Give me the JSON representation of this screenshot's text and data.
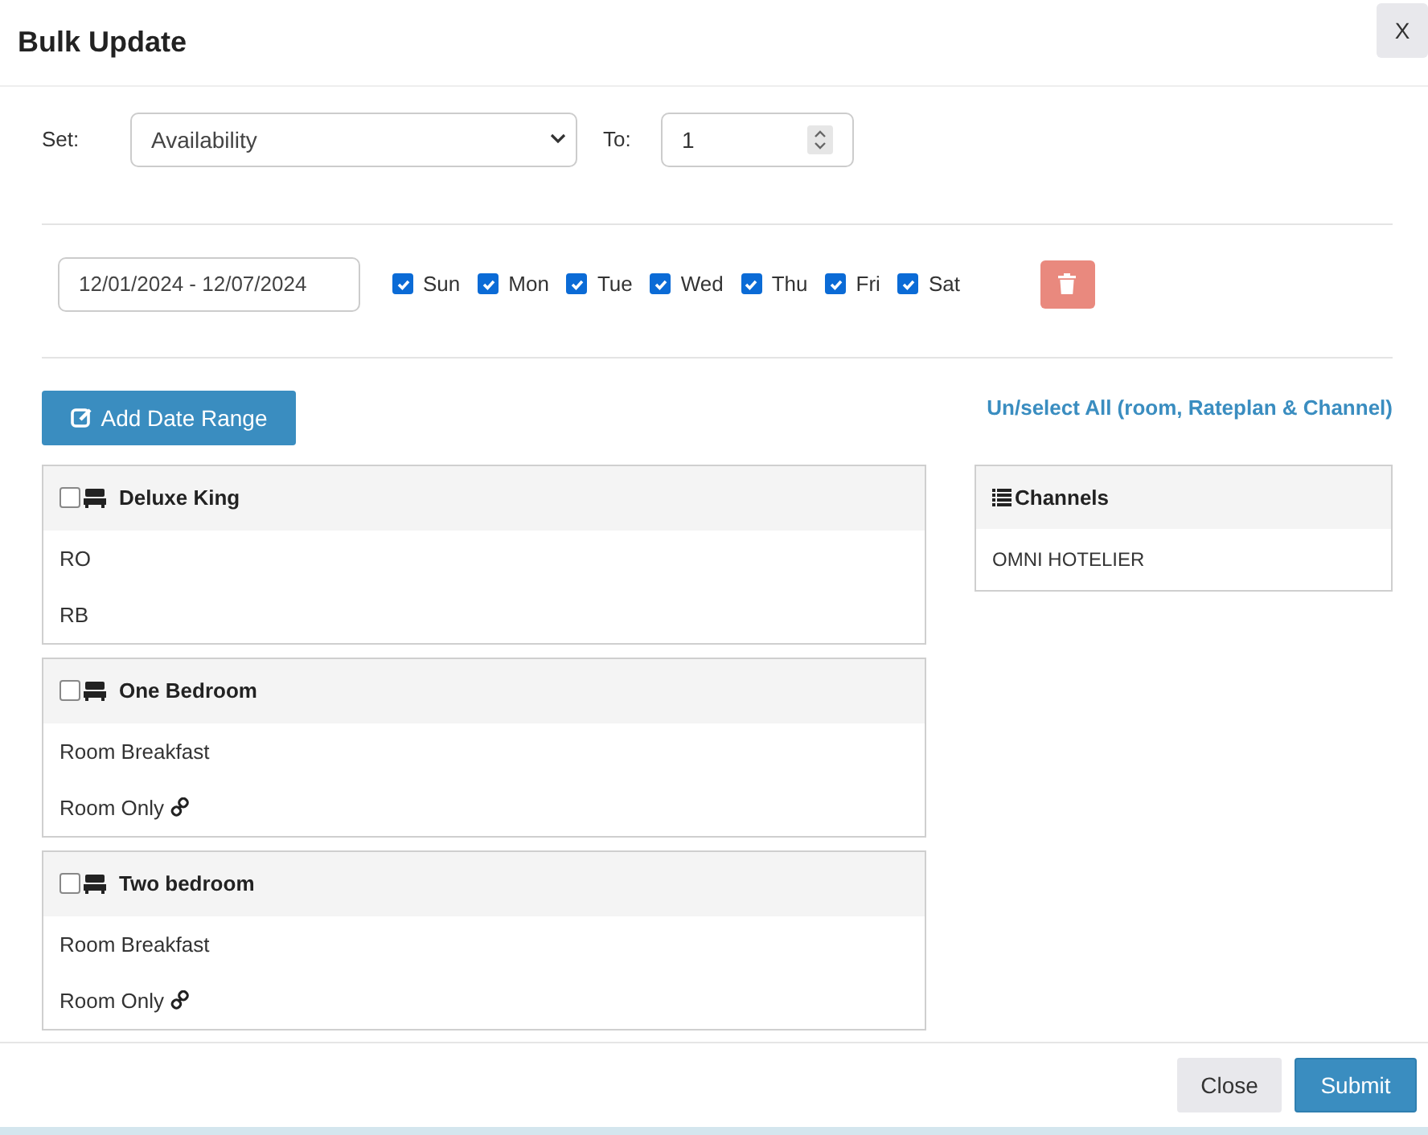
{
  "modal": {
    "title": "Bulk Update",
    "close_label": "X"
  },
  "set_row": {
    "set_label": "Set:",
    "field": "Availability",
    "to_label": "To:",
    "value": "1"
  },
  "date_ranges": [
    {
      "range": "12/01/2024 - 12/07/2024",
      "days": [
        {
          "label": "Sun",
          "checked": true
        },
        {
          "label": "Mon",
          "checked": true
        },
        {
          "label": "Tue",
          "checked": true
        },
        {
          "label": "Wed",
          "checked": true
        },
        {
          "label": "Thu",
          "checked": true
        },
        {
          "label": "Fri",
          "checked": true
        },
        {
          "label": "Sat",
          "checked": true
        }
      ]
    }
  ],
  "add_button": "Add Date Range",
  "select_all_link": "Un/select All (room, Rateplan & Channel)",
  "rooms": [
    {
      "name": "Deluxe King",
      "checked": false,
      "rate_plans": [
        {
          "name": "RO",
          "linked": false
        },
        {
          "name": "RB",
          "linked": false
        }
      ]
    },
    {
      "name": "One Bedroom",
      "checked": false,
      "rate_plans": [
        {
          "name": "Room Breakfast",
          "linked": false
        },
        {
          "name": "Room Only",
          "linked": true
        }
      ]
    },
    {
      "name": "Two bedroom",
      "checked": false,
      "rate_plans": [
        {
          "name": "Room Breakfast",
          "linked": false
        },
        {
          "name": "Room Only",
          "linked": true
        }
      ]
    }
  ],
  "channels": {
    "title": "Channels",
    "items": [
      "OMNI HOTELIER"
    ]
  },
  "footer": {
    "buttons": [
      {
        "label": "Close",
        "kind": "secondary"
      },
      {
        "label": "Submit",
        "kind": "primary"
      }
    ]
  }
}
